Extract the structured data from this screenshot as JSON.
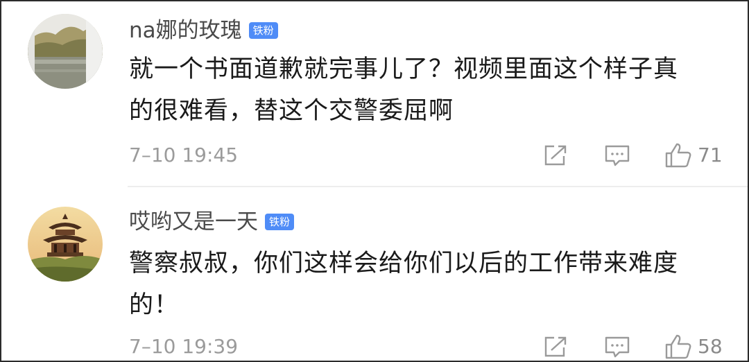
{
  "comments": [
    {
      "username": "na娜的玫瑰",
      "badge": "铁粉",
      "text_line1": "就一个书面道歉就完事儿了？视频里面这个样子真",
      "text_line2": "的很难看，替这个交警委屈啊",
      "timestamp": "7–10 19:45",
      "likes": "71",
      "avatar": "landscape-avatar"
    },
    {
      "username": "哎哟又是一天",
      "badge": "铁粉",
      "text_line1": "警察叔叔，你们这样会给你们以后的工作带来难度",
      "text_line2": "的！",
      "timestamp": "7–10 19:39",
      "likes": "58",
      "avatar": "pavilion-avatar"
    }
  ],
  "icons": {
    "share": "share-icon",
    "reply": "comment-icon",
    "like": "thumbs-up-icon"
  },
  "colors": {
    "badge": "#4f8cf7",
    "username": "#4a4a4a",
    "text": "#1a1a1a",
    "meta": "#9b9b9b"
  }
}
